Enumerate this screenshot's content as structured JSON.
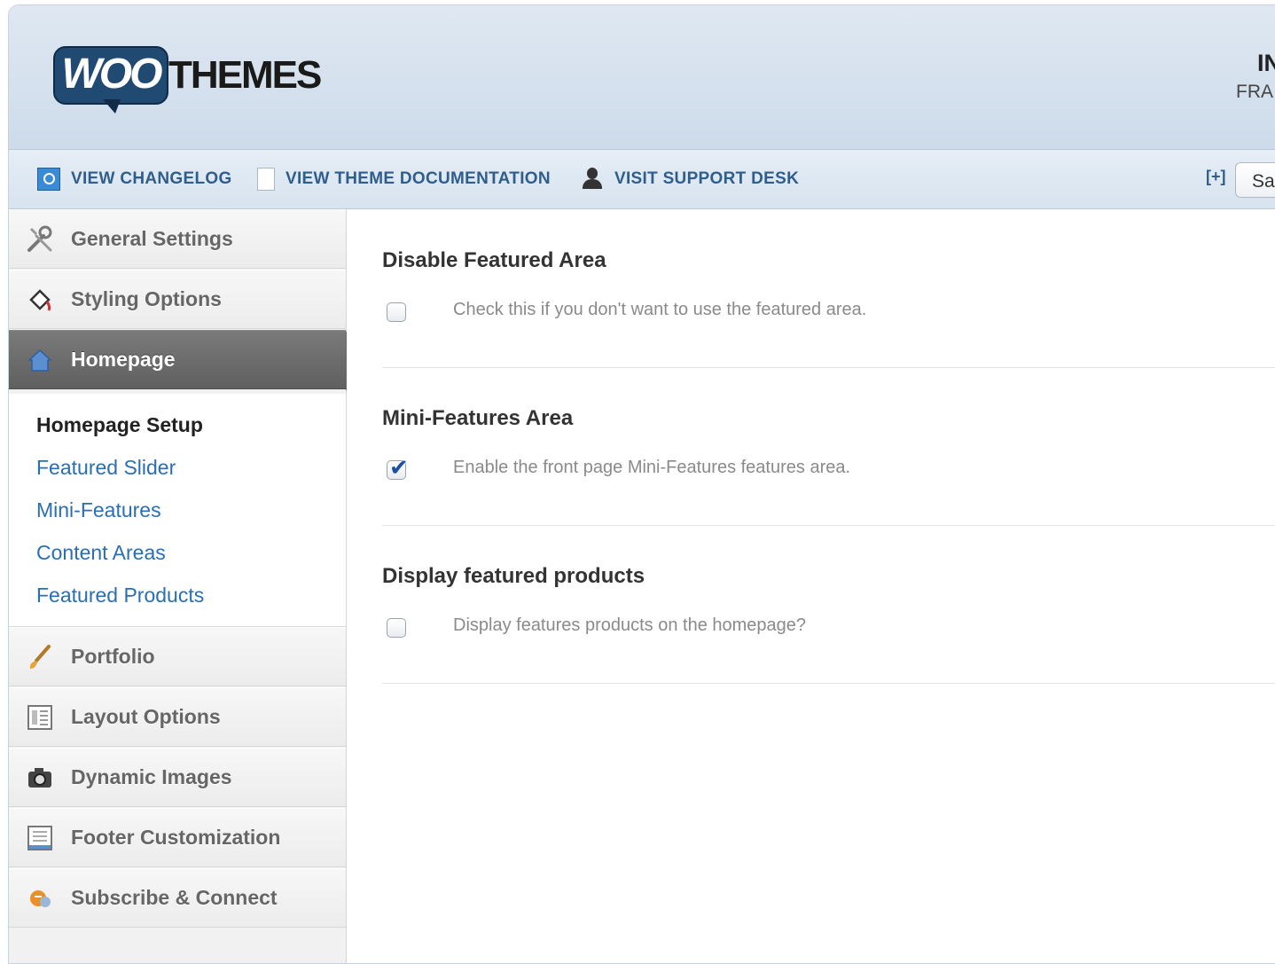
{
  "header": {
    "logo_word": "WOO",
    "logo_suffix": "THEMES",
    "theme_name_partial": "IN",
    "framework_label_partial": "FRA"
  },
  "toolbar": {
    "changelog_label": "VIEW CHANGELOG",
    "documentation_label": "VIEW THEME DOCUMENTATION",
    "support_label": "VISIT SUPPORT DESK",
    "expand_label": "[+]",
    "save_label_partial": "Sa"
  },
  "sidebar": {
    "items": [
      {
        "label": "General Settings",
        "icon": "tools-icon"
      },
      {
        "label": "Styling Options",
        "icon": "paint-bucket-icon"
      },
      {
        "label": "Homepage",
        "icon": "home-icon",
        "active": true
      },
      {
        "label": "Portfolio",
        "icon": "brush-icon"
      },
      {
        "label": "Layout Options",
        "icon": "layout-icon"
      },
      {
        "label": "Dynamic Images",
        "icon": "camera-icon"
      },
      {
        "label": "Footer Customization",
        "icon": "footer-icon"
      },
      {
        "label": "Subscribe & Connect",
        "icon": "connect-icon"
      }
    ],
    "subnav": [
      {
        "label": "Homepage Setup",
        "current": true
      },
      {
        "label": "Featured Slider"
      },
      {
        "label": "Mini-Features"
      },
      {
        "label": "Content Areas"
      },
      {
        "label": "Featured Products"
      }
    ]
  },
  "main": {
    "sections": [
      {
        "title": "Disable Featured Area",
        "description": "Check this if you don't want to use the featured area.",
        "checked": false
      },
      {
        "title": "Mini-Features Area",
        "description": "Enable the front page Mini-Features features area.",
        "checked": true
      },
      {
        "title": "Display featured products",
        "description": "Display features products on the homepage?",
        "checked": false
      }
    ]
  },
  "colors": {
    "accent_link": "#2a6eb3",
    "toolbar_text": "#2f5e8c",
    "active_nav": "#666666"
  }
}
